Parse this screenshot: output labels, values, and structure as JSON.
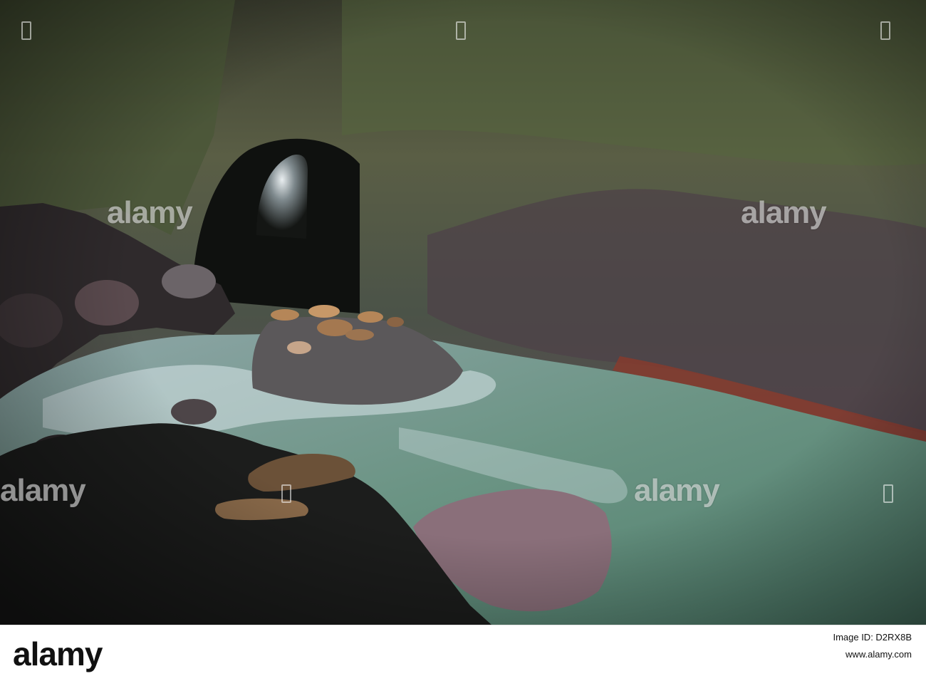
{
  "watermark": {
    "text": "alamy"
  },
  "footer": {
    "logo": "alamy",
    "image_id_line": "Image ID: D2RX8B",
    "url": "www.alamy.com"
  },
  "colors": {
    "water": "#5f8a7a",
    "rock_dark": "#1e2120",
    "cave_wall": "#4a5248",
    "moss": "#6d8a4e",
    "sea_lion": "#b58658",
    "foam": "#d9e6ea"
  }
}
